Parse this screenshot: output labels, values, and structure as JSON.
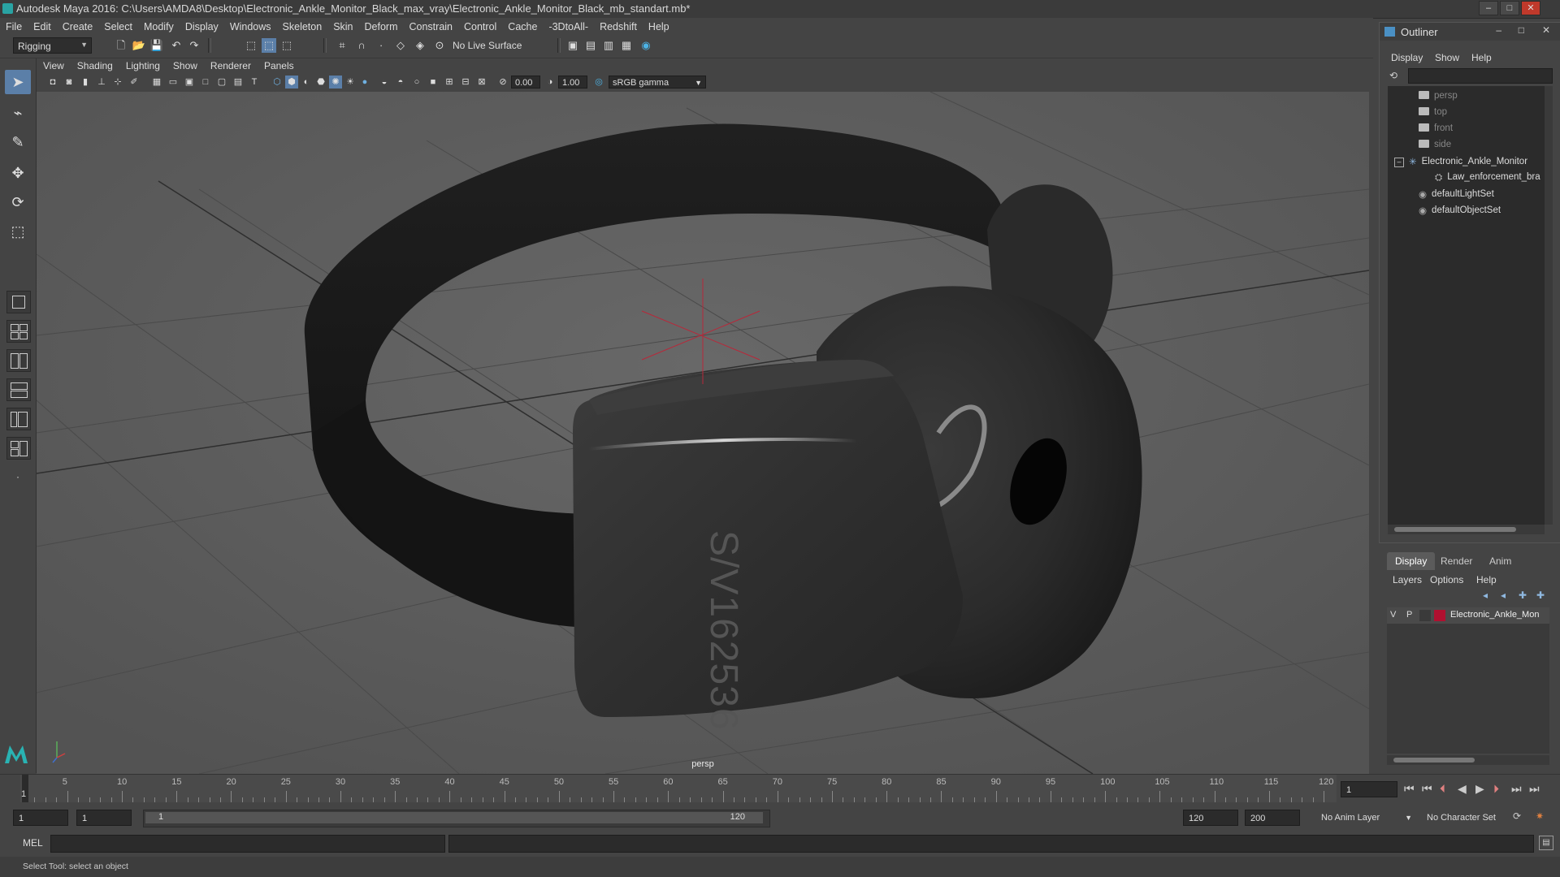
{
  "window": {
    "title": "Autodesk Maya 2016: C:\\Users\\AMDA8\\Desktop\\Electronic_Ankle_Monitor_Black_max_vray\\Electronic_Ankle_Monitor_Black_mb_standart.mb*",
    "controls": [
      "–",
      "□",
      "✕"
    ]
  },
  "menubar": [
    "File",
    "Edit",
    "Create",
    "Select",
    "Modify",
    "Display",
    "Windows",
    "Skeleton",
    "Skin",
    "Deform",
    "Constrain",
    "Control",
    "Cache",
    "-3DtoAll-",
    "Redshift",
    "Help"
  ],
  "shelf": {
    "menuset": "Rigging",
    "live_surface": "No Live Surface"
  },
  "panel": {
    "menus": [
      "View",
      "Shading",
      "Lighting",
      "Show",
      "Renderer",
      "Panels"
    ],
    "exposure": "0.00",
    "gamma": "1.00",
    "color_space": "sRGB gamma",
    "camera_label": "persp"
  },
  "model": {
    "engraving": "S/V162536"
  },
  "outliner": {
    "title": "Outliner",
    "menus": [
      "Display",
      "Show",
      "Help"
    ],
    "items": [
      {
        "label": "persp",
        "icon": "camera-icon",
        "dim": true
      },
      {
        "label": "top",
        "icon": "camera-icon",
        "dim": true
      },
      {
        "label": "front",
        "icon": "camera-icon",
        "dim": true
      },
      {
        "label": "side",
        "icon": "camera-icon",
        "dim": true
      },
      {
        "label": "Electronic_Ankle_Monitor",
        "icon": "group-icon",
        "dim": false
      },
      {
        "label": "Law_enforcement_bra",
        "icon": "mesh-icon",
        "dim": false
      },
      {
        "label": "defaultLightSet",
        "icon": "set-icon",
        "dim": false
      },
      {
        "label": "defaultObjectSet",
        "icon": "set-icon",
        "dim": false
      }
    ]
  },
  "layer_editor": {
    "tabs": [
      "Display",
      "Render",
      "Anim"
    ],
    "menus": [
      "Layers",
      "Options",
      "Help"
    ],
    "layer": {
      "v": "V",
      "p": "P",
      "name": "Electronic_Ankle_Mon",
      "color": "#b01030"
    }
  },
  "timeline": {
    "ticks": [
      5,
      10,
      15,
      20,
      25,
      30,
      35,
      40,
      45,
      50,
      55,
      60,
      65,
      70,
      75,
      80,
      85,
      90,
      95,
      100,
      105,
      110,
      115,
      120
    ],
    "current_frame_marker": "1",
    "current_frame": "1"
  },
  "range": {
    "start": "1",
    "playback_start": "1",
    "slider_start": "1",
    "slider_end": "120",
    "playback_end": "120",
    "end": "200",
    "anim_layer": "No Anim Layer",
    "character_set": "No Character Set"
  },
  "command": {
    "lang": "MEL"
  },
  "help": {
    "text": "Select Tool: select an object"
  }
}
